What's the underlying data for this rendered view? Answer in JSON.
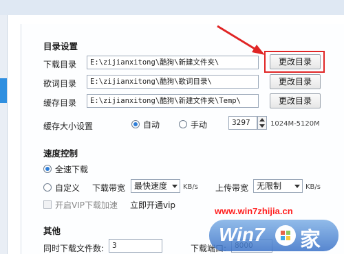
{
  "dir_settings": {
    "title": "目录设置",
    "download": {
      "label": "下载目录",
      "value": "E:\\zijianxitong\\酷狗\\新建文件夹\\",
      "button": "更改目录"
    },
    "lyrics": {
      "label": "歌词目录",
      "value": "E:\\zijianxitong\\酷狗\\歌词目录\\",
      "button": "更改目录"
    },
    "cache": {
      "label": "缓存目录",
      "value": "E:\\zijianxitong\\酷狗\\新建文件夹\\Temp\\",
      "button": "更改目录"
    },
    "cache_size": {
      "label": "缓存大小设置",
      "auto": "自动",
      "manual": "手动",
      "value": "3297",
      "range": "1024M-5120M",
      "selected": "auto"
    }
  },
  "speed": {
    "title": "速度控制",
    "full": "全速下载",
    "custom": "自定义",
    "download_bw_label": "下载带宽",
    "download_bw_value": "最快速度",
    "download_unit": "KB/s",
    "upload_bw_label": "上传带宽",
    "upload_bw_value": "无限制",
    "upload_unit": "KB/s",
    "vip_accel": "开启VIP下载加速",
    "vip_link": "立即开通vip",
    "selected": "full"
  },
  "other": {
    "title": "其他",
    "concurrent_label": "同时下载文件数:",
    "concurrent_value": "3",
    "port_label": "下载端口:",
    "port_value": "8000"
  },
  "watermark": {
    "url": "www.win7zhijia.cn",
    "logo_text": "Win7",
    "logo_char": "家"
  },
  "colors": {
    "accent": "#2f8fe0",
    "highlight": "#e02525",
    "watermark_text": "#ff2020"
  }
}
